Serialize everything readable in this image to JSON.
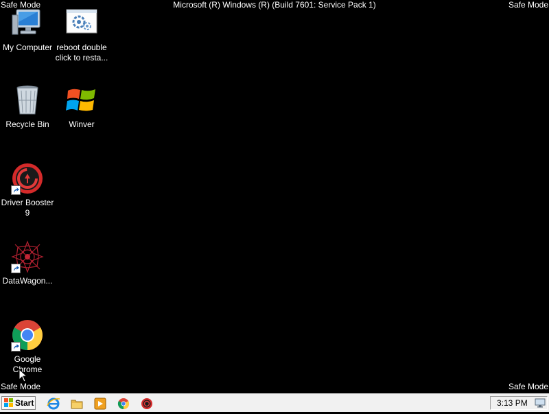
{
  "safe_mode": {
    "top_left": "Safe Mode",
    "top_right": "Safe Mode",
    "bottom_left": "Safe Mode",
    "bottom_right": "Safe Mode"
  },
  "windows_version": "Microsoft (R) Windows (R) (Build 7601: Service Pack 1)",
  "desktop_icons": [
    {
      "label": "My Computer",
      "icon": "computer-icon"
    },
    {
      "label": "reboot double click to resta...",
      "icon": "script-file-icon"
    },
    {
      "label": "Recycle Bin",
      "icon": "recycle-bin-icon"
    },
    {
      "label": "Winver",
      "icon": "windows-logo-icon"
    },
    {
      "label": "Driver Booster 9",
      "icon": "driver-booster-icon",
      "shortcut": true
    },
    {
      "label": "DataWagon...",
      "icon": "datawagon-icon",
      "shortcut": true
    },
    {
      "label": "Google Chrome",
      "icon": "chrome-icon",
      "shortcut": true
    }
  ],
  "taskbar": {
    "start_label": "Start",
    "pinned": [
      {
        "name": "internet-explorer-icon"
      },
      {
        "name": "file-explorer-icon"
      },
      {
        "name": "media-player-icon"
      },
      {
        "name": "chrome-icon"
      },
      {
        "name": "driver-booster-icon"
      }
    ],
    "clock": "3:13 PM"
  },
  "colors": {
    "desktop_background": "#000000",
    "taskbar_background": "#f1f1f1"
  }
}
